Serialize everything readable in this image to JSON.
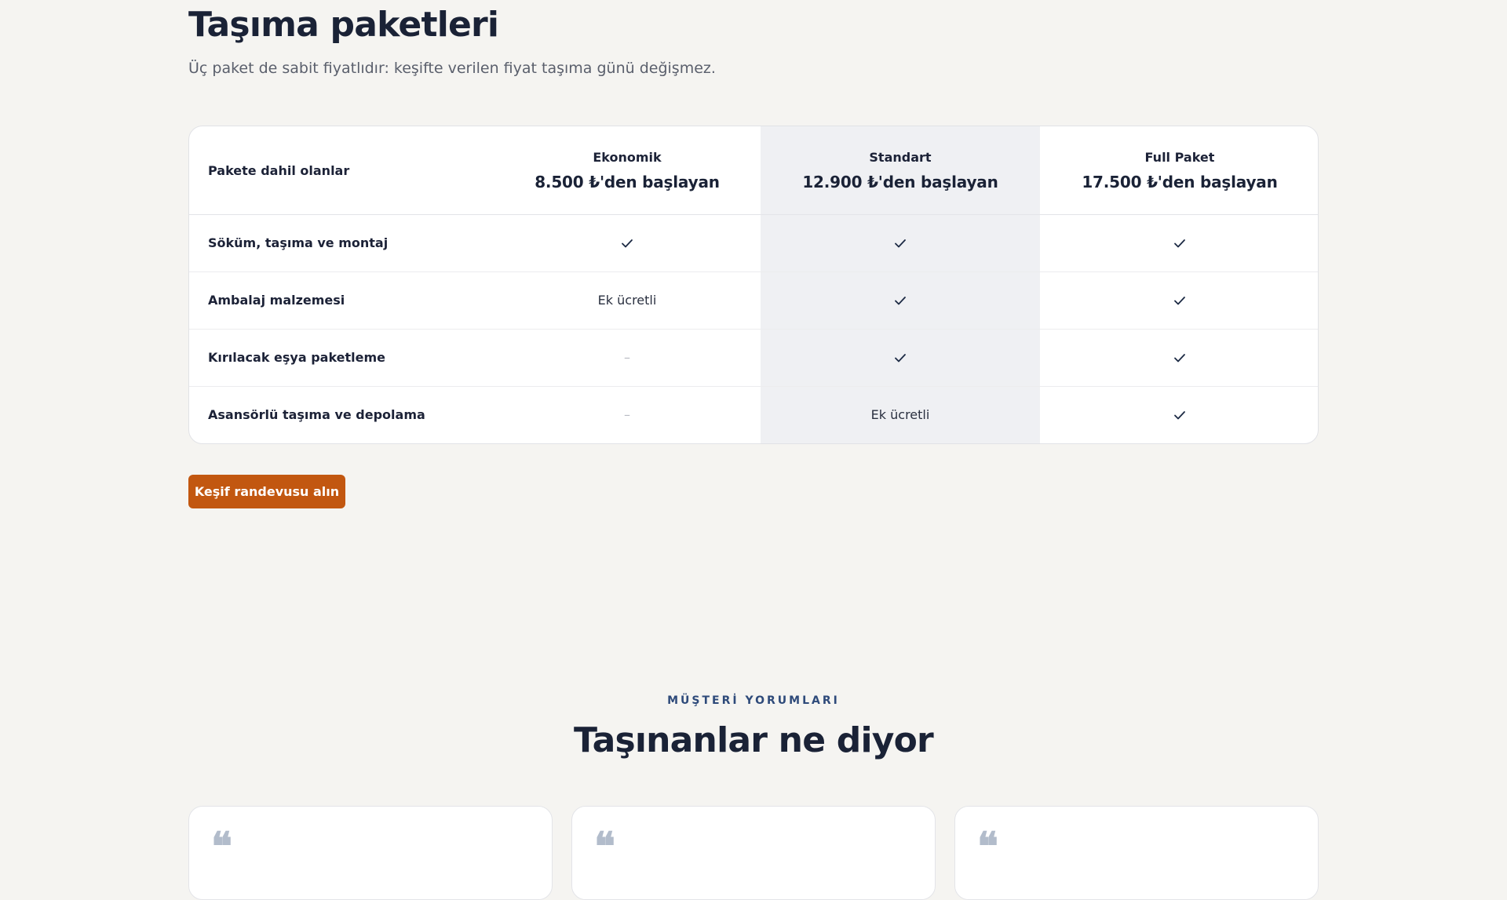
{
  "header": {
    "title": "Taşıma paketleri",
    "subtitle": "Üç paket de sabit fiyatlıdır: keşifte verilen fiyat taşıma günü değişmez."
  },
  "pricing_table": {
    "first_column_header": "Pakete dahil olanlar",
    "plans": [
      {
        "name": "Ekonomik",
        "price": "8.500 ₺'den başlayan"
      },
      {
        "name": "Standart",
        "price": "12.900 ₺'den başlayan",
        "highlighted": true
      },
      {
        "name": "Full Paket",
        "price": "17.500 ₺'den başlayan"
      }
    ],
    "rows": [
      {
        "feature": "Söküm, taşıma ve montaj",
        "values": [
          "check",
          "check",
          "check"
        ]
      },
      {
        "feature": "Ambalaj malzemesi",
        "values": [
          "Ek ücretli",
          "check",
          "check"
        ]
      },
      {
        "feature": "Kırılacak eşya paketleme",
        "values": [
          "–",
          "check",
          "check"
        ]
      },
      {
        "feature": "Asansörlü taşıma ve depolama",
        "values": [
          "–",
          "Ek ücretli",
          "check"
        ]
      }
    ],
    "value_labels": {
      "extra_cost": "Ek ücretli",
      "not_included": "–"
    },
    "icons": {
      "included": "check-icon"
    }
  },
  "cta": {
    "label": "Keşif randevusu alın"
  },
  "testimonials": {
    "eyebrow": "MÜŞTERİ YORUMLARI",
    "title": "Taşınanlar ne diyor",
    "quote_glyph": "❝",
    "cards": [
      {
        "icon": "quote-icon"
      },
      {
        "icon": "quote-icon"
      },
      {
        "icon": "quote-icon"
      }
    ]
  },
  "colors": {
    "background": "#f5f4f1",
    "accent": "#c25710",
    "heading": "#1a2236",
    "eyebrow": "#2e4a7a",
    "highlight_column": "#eff0f3"
  }
}
